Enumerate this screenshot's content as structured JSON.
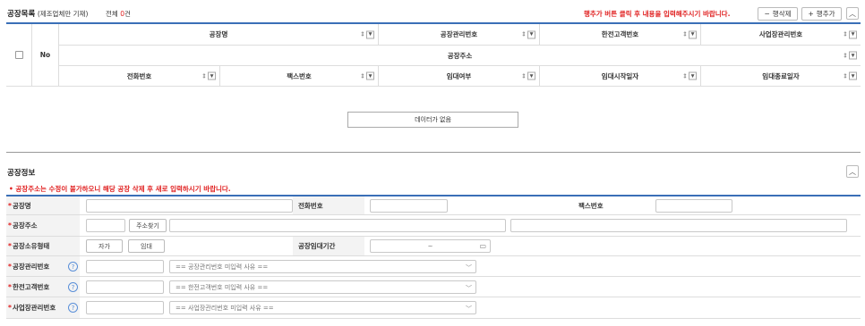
{
  "list": {
    "title": "공장목록",
    "subtitle": "(제조업체만 기재)",
    "count_prefix": "전체",
    "count_value": "0",
    "count_suffix": "건",
    "hint": "행추가 버튼 클릭 후 내용을 입력해주시기 바랍니다.",
    "delete_row_label": "행삭제",
    "add_row_label": "행추가",
    "columns_row1": [
      "공장명",
      "공장관리번호",
      "한전고객번호",
      "사업장관리번호"
    ],
    "column_no": "No",
    "column_address": "공장주소",
    "columns_row3": [
      "전화번호",
      "팩스번호",
      "임대여부",
      "임대시작일자",
      "임대종료일자"
    ],
    "empty_message": "데이터가 없음"
  },
  "form": {
    "title": "공장정보",
    "notice": "• 공장주소는 수정이 불가하오니 해당 공장 삭제 후 새로 입력하시기 바랍니다.",
    "labels": {
      "factory_name": "공장명",
      "phone": "전화번호",
      "fax": "팩스번호",
      "address": "공장주소",
      "ownership": "공장소유형태",
      "lease_period": "공장임대기간",
      "factory_mgmt_no": "공장관리번호",
      "kepco_no": "한전고객번호",
      "biz_mgmt_no": "사업장관리번호"
    },
    "address_search_label": "주소찾기",
    "own_label": "자가",
    "lease_label": "임대",
    "period_sep": "~",
    "dropdowns": {
      "factory_mgmt": "== 공장관리번호 미입력 사유 ==",
      "kepco": "== 한전고객번호 미입력 사유 ==",
      "biz_mgmt": "== 사업장관리번호 미입력 사유 =="
    }
  }
}
